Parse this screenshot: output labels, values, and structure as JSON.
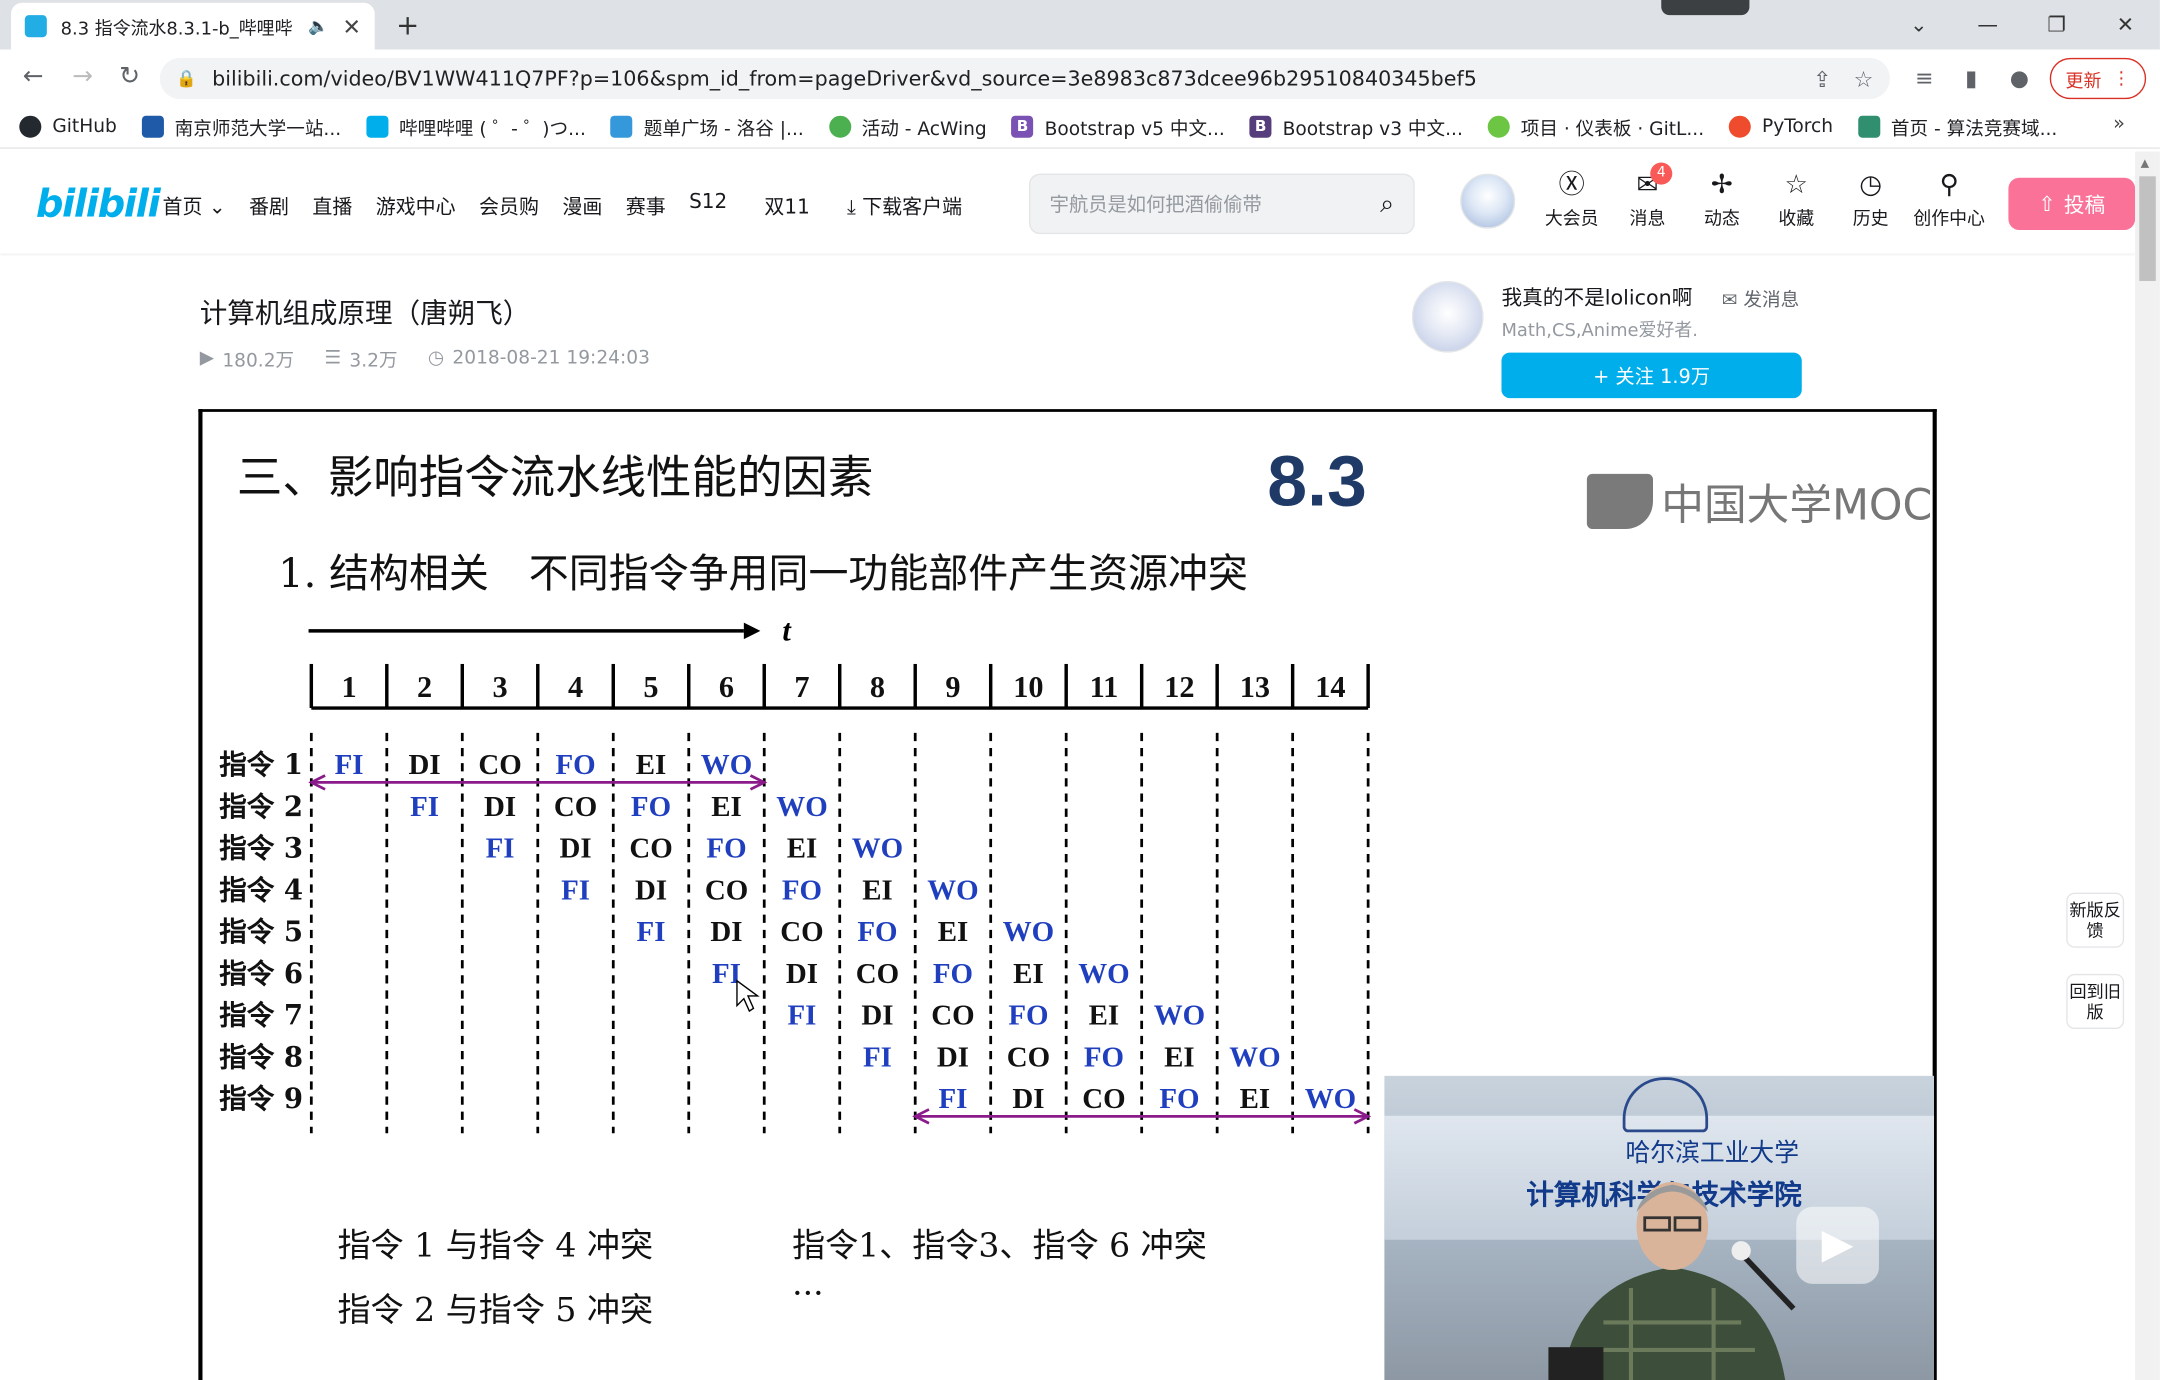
{
  "browser": {
    "tab_title": "8.3 指令流水8.3.1-b_哔哩哔",
    "url": "bilibili.com/video/BV1WW411Q7PF?p=106&spm_id_from=pageDriver&vd_source=3e8983c873dcee96b29510840345bef5",
    "update_label": "更新",
    "bookmarks": [
      {
        "label": "GitHub",
        "icon": "github-icon",
        "color": "#24292f"
      },
      {
        "label": "南京师范大学一站...",
        "icon": "nnu-icon",
        "color": "#1e5aa8"
      },
      {
        "label": "哔哩哔哩 ( ゜- ゜)つ...",
        "icon": "bilibili-icon",
        "color": "#00aeec"
      },
      {
        "label": "题单广场 - 洛谷 |...",
        "icon": "luogu-icon",
        "color": "#3498db"
      },
      {
        "label": "活动 - AcWing",
        "icon": "acwing-icon",
        "color": "#4caf50"
      },
      {
        "label": "Bootstrap v5 中文...",
        "icon": "bootstrap-icon",
        "color": "#7952b3"
      },
      {
        "label": "Bootstrap v3 中文...",
        "icon": "bootstrap-icon",
        "color": "#563d7c"
      },
      {
        "label": "项目 · 仪表板 · GitL...",
        "icon": "gitlab-icon",
        "color": "#6cc644"
      },
      {
        "label": "PyTorch",
        "icon": "pytorch-icon",
        "color": "#ee4c2c"
      },
      {
        "label": "首页 - 算法竞赛域...",
        "icon": "algo-icon",
        "color": "#2f8f6f"
      }
    ]
  },
  "site": {
    "nav": [
      "首页",
      "番剧",
      "直播",
      "游戏中心",
      "会员购",
      "漫画",
      "赛事",
      "S12",
      "双11",
      "下载客户端"
    ],
    "search_placeholder": "宇航员是如何把酒偷偷带",
    "header_icons": [
      {
        "label": "大会员",
        "icon": "vip-icon"
      },
      {
        "label": "消息",
        "icon": "message-icon"
      },
      {
        "label": "动态",
        "icon": "dynamic-icon"
      },
      {
        "label": "收藏",
        "icon": "favorite-icon"
      },
      {
        "label": "历史",
        "icon": "history-icon"
      },
      {
        "label": "创作中心",
        "icon": "creator-icon"
      }
    ],
    "message_badge": "4",
    "upload_label": "投稿"
  },
  "video": {
    "title": "计算机组成原理（唐朔飞）",
    "views": "180.2万",
    "danmaku": "3.2万",
    "date": "2018-08-21 19:24:03"
  },
  "uploader": {
    "name": "我真的不是lolicon啊",
    "message_label": "发消息",
    "desc": "Math,CS,Anime爱好者.",
    "follow_label": "+ 关注 1.9万"
  },
  "side_buttons": [
    "新版反馈",
    "回到旧版"
  ],
  "slide": {
    "title": "三、影响指令流水线性能的因素",
    "section_number": "8.3",
    "logo_text": "中国大学MOC",
    "subtitle": "1. 结构相关　不同指令争用同一功能部件产生资源冲突",
    "time_label": "t",
    "cycles": [
      "1",
      "2",
      "3",
      "4",
      "5",
      "6",
      "7",
      "8",
      "9",
      "10",
      "11",
      "12",
      "13",
      "14"
    ],
    "instructions": [
      {
        "label": "指令 1",
        "start": 1,
        "stages": [
          "FI",
          "DI",
          "CO",
          "FO",
          "EI",
          "WO"
        ]
      },
      {
        "label": "指令 2",
        "start": 2,
        "stages": [
          "FI",
          "DI",
          "CO",
          "FO",
          "EI",
          "WO"
        ]
      },
      {
        "label": "指令 3",
        "start": 3,
        "stages": [
          "FI",
          "DI",
          "CO",
          "FO",
          "EI",
          "WO"
        ]
      },
      {
        "label": "指令 4",
        "start": 4,
        "stages": [
          "FI",
          "DI",
          "CO",
          "FO",
          "EI",
          "WO"
        ]
      },
      {
        "label": "指令 5",
        "start": 5,
        "stages": [
          "FI",
          "DI",
          "CO",
          "FO",
          "EI",
          "WO"
        ]
      },
      {
        "label": "指令 6",
        "start": 6,
        "stages": [
          "FI",
          "DI",
          "CO",
          "FO",
          "EI",
          "WO"
        ]
      },
      {
        "label": "指令 7",
        "start": 7,
        "stages": [
          "FI",
          "DI",
          "CO",
          "FO",
          "EI",
          "WO"
        ]
      },
      {
        "label": "指令 8",
        "start": 8,
        "stages": [
          "FI",
          "DI",
          "CO",
          "FO",
          "EI",
          "WO"
        ]
      },
      {
        "label": "指令 9",
        "start": 9,
        "stages": [
          "FI",
          "DI",
          "CO",
          "FO",
          "EI",
          "WO"
        ]
      }
    ],
    "blue_stages": [
      "FI",
      "FO",
      "WO"
    ],
    "black_stage_color": "#111111",
    "blue_stage_color": "#1f3fbf",
    "arrow_color": "#8b1a8b",
    "conflicts": [
      "指令 1 与指令 4 冲突",
      "指令1、指令3、指令 6 冲突",
      "指令 2 与指令 5 冲突",
      "···"
    ],
    "inset_school": "哈尔滨工业大学",
    "inset_dept": "计算机科学与技术学院"
  }
}
